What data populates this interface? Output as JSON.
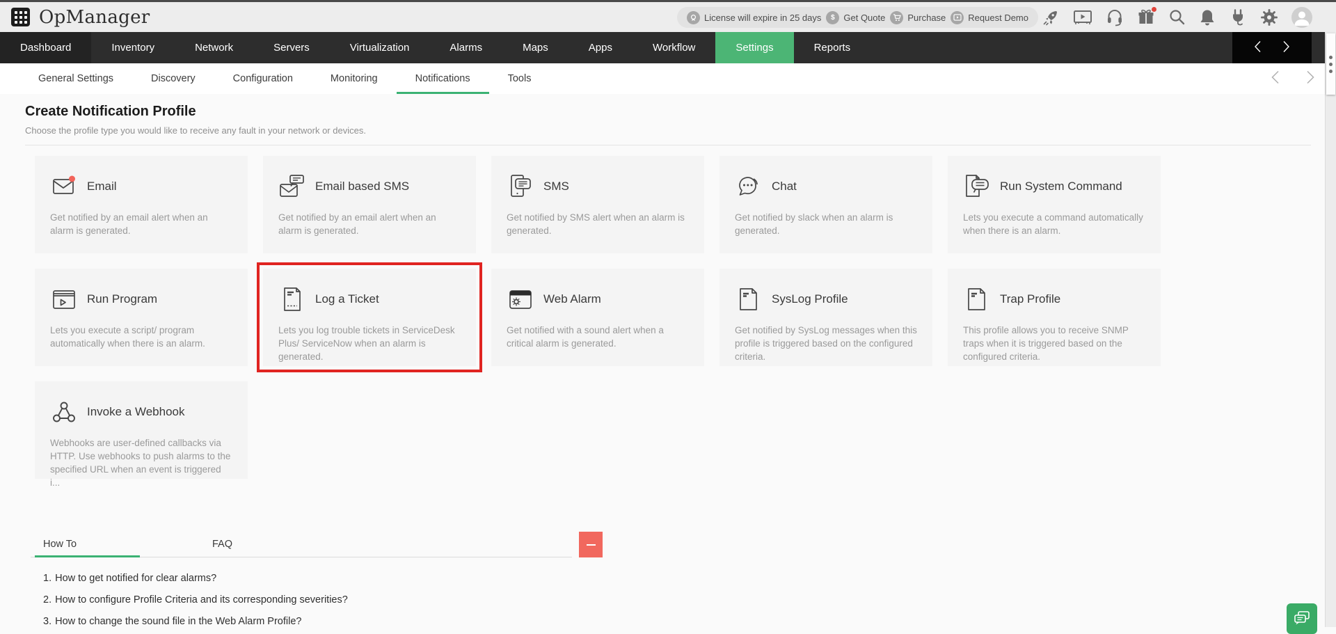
{
  "header": {
    "logo_text": "OpManager",
    "license_banner": {
      "license": "License will expire in 25 days",
      "get_quote": "Get Quote",
      "purchase": "Purchase",
      "request_demo": "Request Demo",
      "quote_symbol": "$"
    }
  },
  "main_nav": {
    "items": [
      "Dashboard",
      "Inventory",
      "Network",
      "Servers",
      "Virtualization",
      "Alarms",
      "Maps",
      "Apps",
      "Workflow",
      "Settings",
      "Reports"
    ],
    "active": "Settings"
  },
  "sub_nav": {
    "items": [
      "General Settings",
      "Discovery",
      "Configuration",
      "Monitoring",
      "Notifications",
      "Tools"
    ],
    "active": "Notifications"
  },
  "page": {
    "title": "Create Notification Profile",
    "subtitle": "Choose the profile type you would like to receive any fault in your network or devices."
  },
  "cards": [
    {
      "title": "Email",
      "desc": "Get notified by an email alert when an alarm is generated."
    },
    {
      "title": "Email based SMS",
      "desc": "Get notified by an email alert when an alarm is generated."
    },
    {
      "title": "SMS",
      "desc": "Get notified by SMS alert when an alarm is generated."
    },
    {
      "title": "Chat",
      "desc": "Get notified by slack when an alarm is generated."
    },
    {
      "title": "Run System Command",
      "desc": "Lets you execute a command automatically when there is an alarm."
    },
    {
      "title": "Run Program",
      "desc": "Lets you execute a script/ program automatically when there is an alarm."
    },
    {
      "title": "Log a Ticket",
      "desc": "Lets you log trouble tickets in ServiceDesk Plus/ ServiceNow when an alarm is generated.",
      "highlighted": true
    },
    {
      "title": "Web Alarm",
      "desc": "Get notified with a sound alert when a critical alarm is generated."
    },
    {
      "title": "SysLog Profile",
      "desc": "Get notified by SysLog messages when this profile is triggered based on the configured criteria."
    },
    {
      "title": "Trap Profile",
      "desc": "This profile allows you to receive SNMP traps when it is triggered based on the configured criteria."
    },
    {
      "title": "Invoke a Webhook",
      "desc": "Webhooks are user-defined callbacks via HTTP. Use webhooks to push alarms to the specified URL when an event is triggered i..."
    }
  ],
  "help": {
    "tabs": [
      {
        "label": "How To",
        "active": true
      },
      {
        "label": "FAQ",
        "active": false
      }
    ],
    "questions": [
      {
        "num": "1.",
        "text": "How to get notified for clear alarms?"
      },
      {
        "num": "2.",
        "text": "How to configure Profile Criteria and its corresponding severities?"
      },
      {
        "num": "3.",
        "text": "How to change the sound file in the Web Alarm Profile?"
      }
    ]
  },
  "colors": {
    "nav_active_green": "#4cb575",
    "tab_underline_green": "#3bb273",
    "highlight_red": "#e02421",
    "collapse_button_red": "#f1685e",
    "chat_fab_green": "#3aab66",
    "notification_dot_red": "#e0433a"
  }
}
